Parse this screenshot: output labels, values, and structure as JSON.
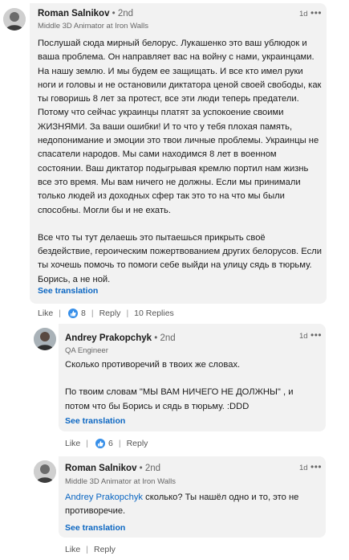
{
  "comments": [
    {
      "author": "Roman Salnikov",
      "degree": "• 2nd",
      "headline": "Middle 3D Animator at Iron Walls",
      "time": "1d",
      "paragraphs": [
        "Послушай сюда мирный белорус. Лукашенко это ваш ублюдок и ваша проблема. Он направляет вас на войну с нами, украинцами. На нашу землю. И мы будем ее защищать. И все кто имел руки ноги и головы и не остановили диктатора ценой своей свободы, как ты говоришь 8 лет за протест, все эти люди теперь предатели. Потому что сейчас украинцы платят за успокоение своими ЖИЗНЯМИ. За ваши ошибки! И то что у тебя плохая память, недопонимание и эмоции это твои личные проблемы. Украинцы не спасатели народов. Мы сами находимся 8 лет в военном состоянии. Ваш диктатор подыгрывая кремлю портил нам жизнь все это время. Мы вам ничего не должны. Если мы принимали только людей из доходных сфер так это то на что мы были способны. Могли бы и не ехать.",
        "Все что ты тут делаешь это пытаешься прикрыть своё бездействие, героическим пожертвованием других белорусов. Если ты хочешь помочь то помоги себе выйди на улицу сядь в тюрьму. Борись, а не ной."
      ],
      "see_translation": "See translation",
      "like_label": "Like",
      "like_count": "8",
      "reply_label": "Reply",
      "replies_label": "10 Replies"
    },
    {
      "author": "Andrey Prakopchyk",
      "degree": "• 2nd",
      "headline": "QA Engineer",
      "time": "1d",
      "paragraphs": [
        "Сколько противоречий в твоих же словах.",
        "По твоим словам \"МЫ ВАМ НИЧЕГО НЕ ДОЛЖНЫ\" , и потом что бы Борись и сядь в тюрьму. :DDD"
      ],
      "see_translation": "See translation",
      "like_label": "Like",
      "like_count": "6",
      "reply_label": "Reply"
    },
    {
      "author": "Roman Salnikov",
      "degree": "• 2nd",
      "headline": "Middle 3D Animator at Iron Walls",
      "time": "1d",
      "mention": "Andrey Prakopchyk",
      "text": " сколько? Ты нашёл одно и то, это не противоречие.",
      "see_translation": "See translation",
      "like_label": "Like",
      "reply_label": "Reply"
    }
  ],
  "icons": {
    "menu": "more-dots-icon",
    "reaction": "thumbs-up-icon"
  },
  "colors": {
    "bubble": "#f2f2f2",
    "link": "#0a66c2",
    "reaction": "#378fe9"
  }
}
